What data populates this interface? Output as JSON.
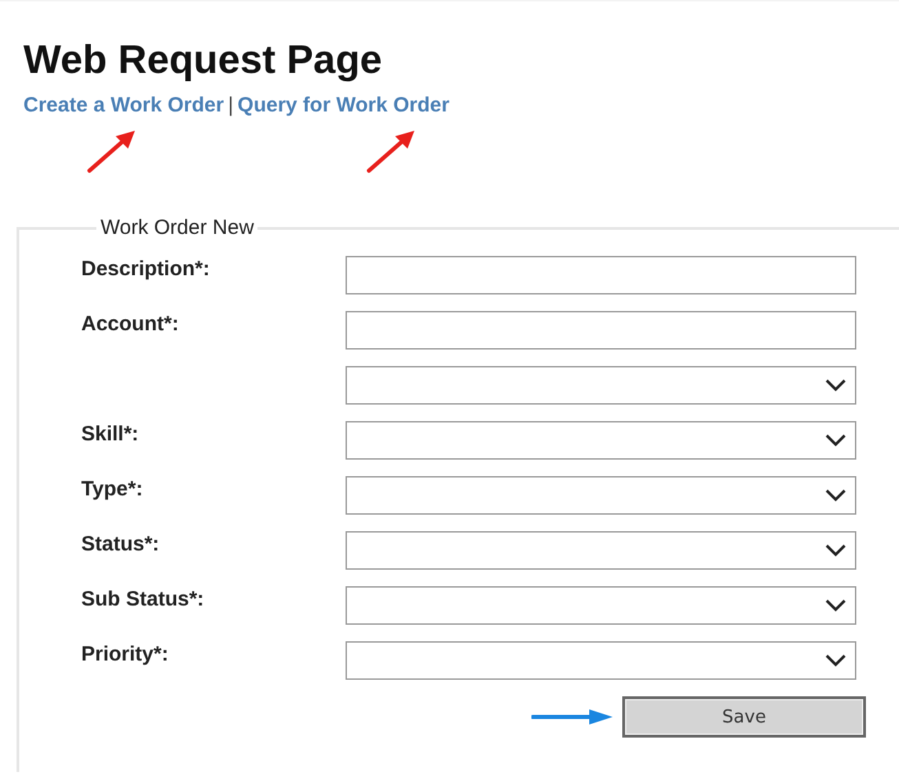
{
  "page": {
    "title": "Web Request Page"
  },
  "links": [
    "Create a Work Order",
    "Query for Work Order"
  ],
  "link_separator": "|",
  "form": {
    "legend": "Work Order New",
    "fields": [
      {
        "label": "Description*:",
        "kind": "text"
      },
      {
        "label": "Account*:",
        "kind": "text"
      },
      {
        "kind": "select"
      },
      {
        "label": "Skill*:",
        "kind": "select"
      },
      {
        "label": "Type*:",
        "kind": "select"
      },
      {
        "label": "Status*:",
        "kind": "select"
      },
      {
        "label": "Sub Status*:",
        "kind": "select"
      },
      {
        "label": "Priority*:",
        "kind": "select"
      }
    ],
    "button": "Save"
  }
}
